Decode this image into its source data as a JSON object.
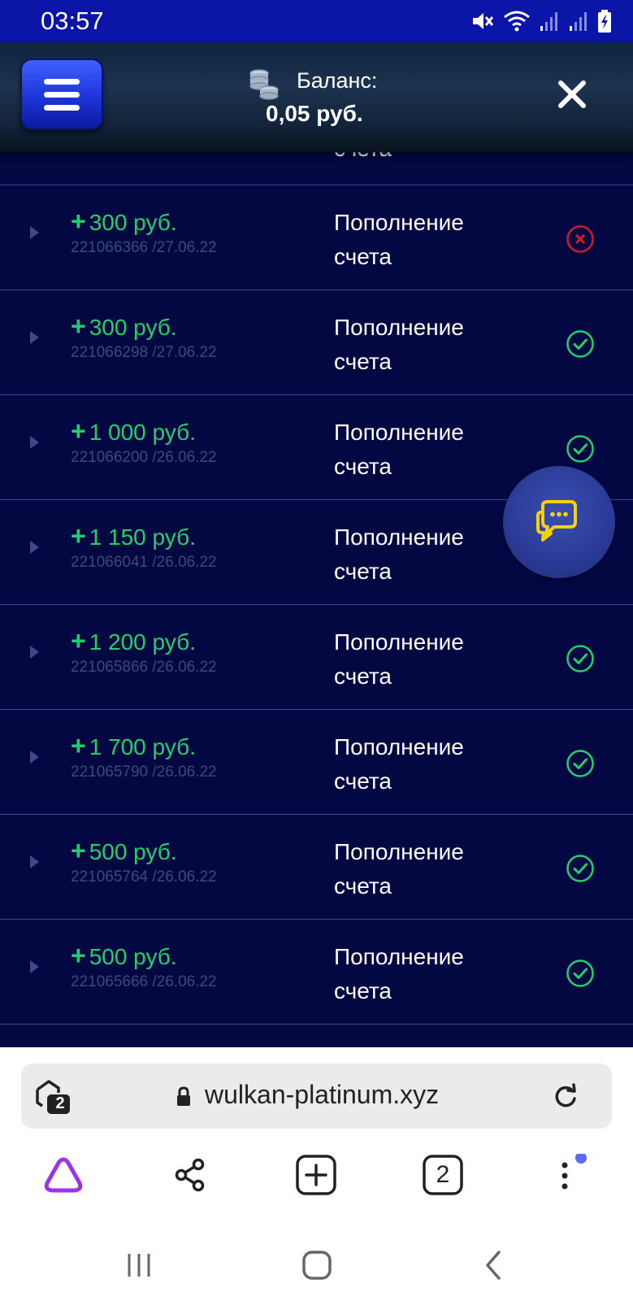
{
  "status_bar": {
    "time": "03:57",
    "icons": [
      "mute-icon",
      "wifi-icon",
      "signal-icon",
      "signal-icon",
      "battery-icon"
    ]
  },
  "header": {
    "menu_icon": "hamburger-icon",
    "balance_label": "Баланс:",
    "balance_value": "0,05 руб.",
    "close_icon": "close-icon"
  },
  "transactions": {
    "partial_top_desc": "счета",
    "rows": [
      {
        "amount": "300 руб.",
        "meta": "221066366 /27.06.22",
        "desc_line1": "Пополнение",
        "desc_line2": "счета",
        "status": "failed"
      },
      {
        "amount": "300 руб.",
        "meta": "221066298 /27.06.22",
        "desc_line1": "Пополнение",
        "desc_line2": "счета",
        "status": "success"
      },
      {
        "amount": "1 000 руб.",
        "meta": "221066200 /26.06.22",
        "desc_line1": "Пополнение",
        "desc_line2": "счета",
        "status": "success"
      },
      {
        "amount": "1 150 руб.",
        "meta": "221066041 /26.06.22",
        "desc_line1": "Пополнение",
        "desc_line2": "счета",
        "status": "hidden"
      },
      {
        "amount": "1 200 руб.",
        "meta": "221065866 /26.06.22",
        "desc_line1": "Пополнение",
        "desc_line2": "счета",
        "status": "success"
      },
      {
        "amount": "1 700 руб.",
        "meta": "221065790 /26.06.22",
        "desc_line1": "Пополнение",
        "desc_line2": "счета",
        "status": "success"
      },
      {
        "amount": "500 руб.",
        "meta": "221065764 /26.06.22",
        "desc_line1": "Пополнение",
        "desc_line2": "счета",
        "status": "success"
      },
      {
        "amount": "500 руб.",
        "meta": "221065666 /26.06.22",
        "desc_line1": "Пополнение",
        "desc_line2": "счета",
        "status": "success"
      }
    ]
  },
  "chat": {
    "icon": "chat-bubble-icon"
  },
  "browser": {
    "tabs_badge": "2",
    "url": "wulkan-platinum.xyz",
    "toolbar": {
      "tabs_count": "2"
    }
  },
  "colors": {
    "background": "#030842",
    "status_bar": "#0b16a8",
    "amount": "#1fd16b",
    "success": "#1fd16b",
    "failed": "#d11a2a"
  }
}
